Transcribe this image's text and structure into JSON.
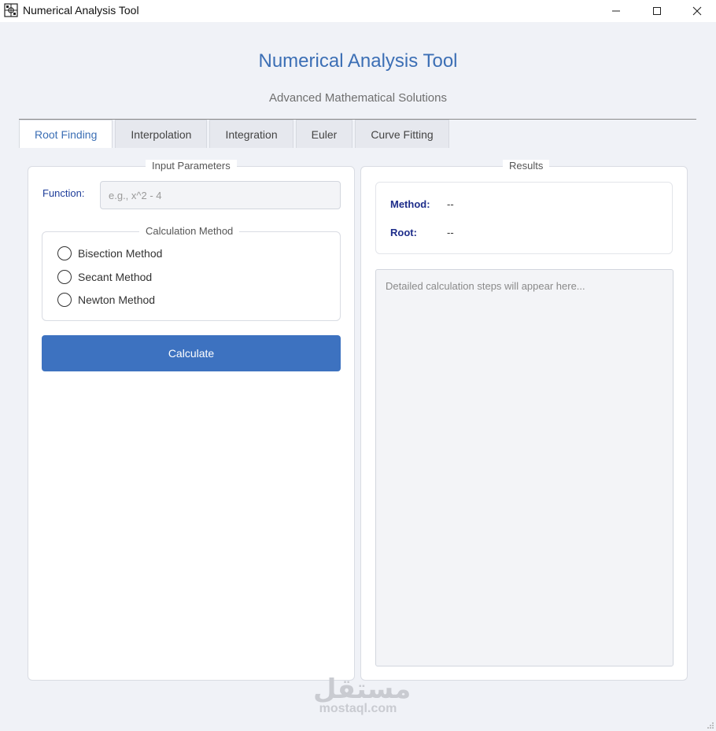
{
  "window": {
    "title": "Numerical Analysis Tool",
    "minimize_icon": "minimize-icon",
    "maximize_icon": "maximize-icon",
    "close_icon": "close-icon"
  },
  "header": {
    "title": "Numerical Analysis Tool",
    "subtitle": "Advanced Mathematical Solutions"
  },
  "tabs": [
    {
      "label": "Root Finding",
      "active": true
    },
    {
      "label": "Interpolation",
      "active": false
    },
    {
      "label": "Integration",
      "active": false
    },
    {
      "label": "Euler",
      "active": false
    },
    {
      "label": "Curve Fitting",
      "active": false
    }
  ],
  "input_panel": {
    "legend": "Input Parameters",
    "function_label": "Function:",
    "function_value": "",
    "function_placeholder": "e.g., x^2 - 4",
    "method_group": {
      "legend": "Calculation Method",
      "options": [
        {
          "label": "Bisection Method",
          "selected": false
        },
        {
          "label": "Secant Method",
          "selected": false
        },
        {
          "label": "Newton Method",
          "selected": false
        }
      ]
    },
    "calculate_label": "Calculate"
  },
  "results_panel": {
    "legend": "Results",
    "method_label": "Method:",
    "method_value": "--",
    "root_label": "Root:",
    "root_value": "--",
    "steps_placeholder": "Detailed calculation steps will appear here..."
  },
  "watermark": {
    "arabic": "مستقل",
    "latin": "mostaql.com"
  },
  "colors": {
    "accent": "#3c6fb5",
    "button": "#3d72c0",
    "label_blue": "#1e3d9a",
    "background": "#f0f2f7"
  }
}
